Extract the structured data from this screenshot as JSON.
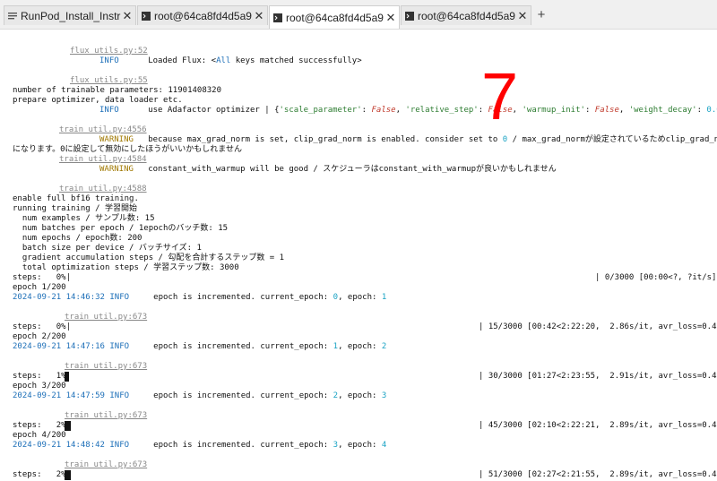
{
  "tabs": [
    {
      "label": "RunPod_Install_Instructions.t",
      "icon": "document-icon"
    },
    {
      "label": "root@64ca8fd4d5a9: /worksp",
      "icon": "terminal-icon"
    },
    {
      "label": "root@64ca8fd4d5a9: /worksp",
      "icon": "terminal-icon"
    },
    {
      "label": "root@64ca8fd4d5a9: /worksp",
      "icon": "terminal-icon"
    }
  ],
  "close_glyph": "✕",
  "newtab_glyph": "+",
  "annotation": "7",
  "log": {
    "l1_src": "flux_utils.py:52",
    "l2_level": "INFO",
    "l2_msg_a": "Loaded Flux: <",
    "l2_msg_all": "All",
    "l2_msg_b": " keys matched successfully>",
    "l3_src": "flux_utils.py:55",
    "l4": "number of trainable parameters: 11901408320",
    "l5": "prepare optimizer, data loader etc.",
    "l6_level": "INFO",
    "l6_a": "use Adafactor optimizer | {",
    "l6_k1": "'scale_parameter'",
    "l6_v1": "False",
    "l6_k2": "'relative_step'",
    "l6_v2": "False",
    "l6_k3": "'warmup_init'",
    "l6_v3": "False",
    "l6_k4": "'weight_decay'",
    "l6_v4": "0.01",
    "l6_end": "}",
    "l7_src": "train_util.py:4556",
    "l8_level": "WARNING",
    "l8_a": "because max_grad_norm is set, clip_grad_norm is enabled. consider set to ",
    "l8_zero": "0",
    "l8_b": " / max_grad_normが設定されているためclip_grad_normが有効",
    "l9": "になります。0に設定して無効にしたほうがいいかもしれません",
    "l10_src": "train_util.py:4584",
    "l11_level": "WARNING",
    "l11_msg": "constant_with_warmup will be good / スケジューラはconstant_with_warmupが良いかもしれません",
    "l12_src": "train_util.py:4588",
    "l13": "enable full bf16 training.",
    "l14": "running training / 学習開始",
    "l15": "  num examples / サンプル数: 15",
    "l16": "  num batches per epoch / 1epochのバッチ数: 15",
    "l17": "  num epochs / epoch数: 200",
    "l18": "  batch size per device / バッチサイズ: 1",
    "l19": "  gradient accumulation steps / 勾配を合計するステップ数 = 1",
    "l20": "  total optimization steps / 学習ステップ数: 3000",
    "s0_left": "steps:   0%|",
    "s0_right": "| 0/3000 [00:00<?, ?it/s]",
    "e1": "epoch 1/200",
    "t1": "2024-09-21 14:46:32",
    "i1_level": "INFO",
    "i1_a": "epoch is incremented. current_epoch: ",
    "i1_c": "0",
    "i1_b": ", epoch: ",
    "i1_e": "1",
    "src_tu": "train_util.py:673",
    "s1_left": "steps:   0%|",
    "s1_right": "| 15/3000 [00:42<2:22:20,  2.86s/it, avr_loss=0.474]",
    "e2": "epoch 2/200",
    "t2": "2024-09-21 14:47:16",
    "i2_c": "1",
    "i2_e": "2",
    "s2_left": "steps:   1%|",
    "s2_right": "| 30/3000 [01:27<2:23:55,  2.91s/it, avr_loss=0.482]",
    "e3": "epoch 3/200",
    "t3": "2024-09-21 14:47:59",
    "i3_c": "2",
    "i3_e": "3",
    "s3_left": "steps:   2%|",
    "s3_right": "| 45/3000 [02:10<2:22:21,  2.89s/it, avr_loss=0.463]",
    "e4": "epoch 4/200",
    "t4": "2024-09-21 14:48:42",
    "i4_c": "3",
    "i4_e": "4",
    "s4_left": "steps:   2%|",
    "s4_right": "| 51/3000 [02:27<2:21:55,  2.89s/it, avr_loss=0.465]"
  }
}
